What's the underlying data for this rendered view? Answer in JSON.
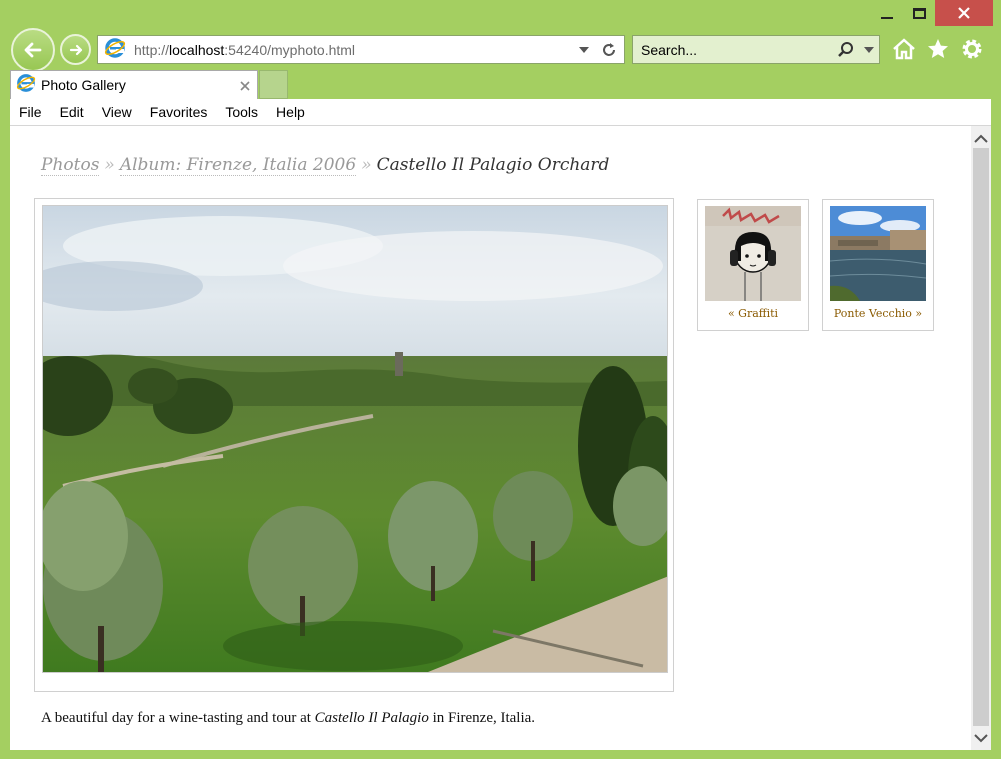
{
  "browser": {
    "address_prefix": "http://",
    "address_host": "localhost",
    "address_rest": ":54240/myphoto.html",
    "search_placeholder": "Search...",
    "tab_title": "Photo Gallery",
    "menu": [
      "File",
      "Edit",
      "View",
      "Favorites",
      "Tools",
      "Help"
    ]
  },
  "page": {
    "breadcrumb": {
      "photos": "Photos",
      "separator": "»",
      "album": "Album: Firenze, Italia 2006",
      "current": "Castello Il Palagio Orchard"
    },
    "thumbnails": [
      {
        "label": "« Graffiti"
      },
      {
        "label": "Ponte Vecchio »"
      }
    ],
    "caption": {
      "before": "A beautiful day for a wine-tasting and tour at ",
      "emphasis": "Castello Il Palagio",
      "after": " in Firenze, Italia."
    }
  },
  "colors": {
    "frame": "#a4cf61",
    "close_button": "#c7504b",
    "link": "#999999",
    "thumb_link": "#8a5a00"
  }
}
